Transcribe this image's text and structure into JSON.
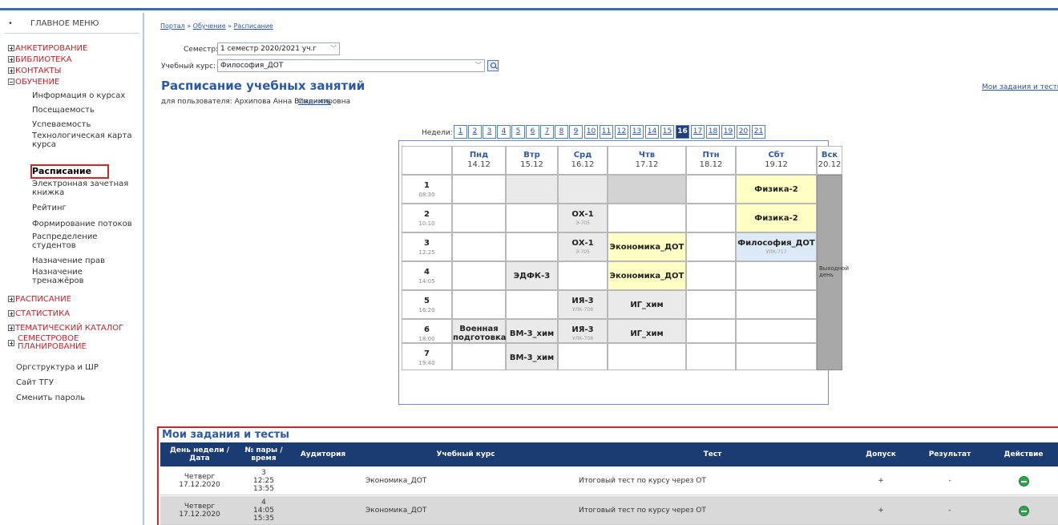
{
  "sidebar": {
    "main_menu": "ГЛАВНОЕ МЕНЮ",
    "sections": {
      "survey": "АНКЕТИРОВАНИЕ",
      "library": "БИБЛИОТЕКА",
      "contacts": "КОНТАКТЫ",
      "education": "ОБУЧЕНИЕ",
      "timetable": "РАСПИСАНИЕ",
      "statistics": "СТАТИСТИКА",
      "catalog": "ТЕМАТИЧЕСКИЙ КАТАЛОГ",
      "planning": "СЕМЕСТРОВОЕ ПЛАНИРОВАНИЕ"
    },
    "education_items": {
      "course_info": "Информация о курсах",
      "attendance": "Посещаемость",
      "progress": "Успеваемость",
      "tech_map": "Технологическая карта курса",
      "schedule": "Расписание",
      "gradebook": "Электронная зачетная книжка",
      "rating": "Рейтинг",
      "streams": "Формирование потоков",
      "distribution": "Распределение студентов",
      "rights": "Назначение прав",
      "trainers": "Назначение тренажёров"
    },
    "org_structure": "Оргструктура и ШР",
    "site": "Сайт ТГУ",
    "change_password": "Сменить пароль"
  },
  "breadcrumb": {
    "portal": "Портал",
    "education": "Обучение",
    "schedule": "Расписание",
    "sep": " » "
  },
  "filters": {
    "semester_label": "Семестр:",
    "semester_value": "1 семестр 2020/2021 уч.г",
    "course_label": "Учебный курс:",
    "course_value": "Философия_ДОТ"
  },
  "page_title": "Расписание учебных занятий",
  "my_tasks_link": "Мои задания и тесты",
  "user_line": "для пользователя: Архипова Анна Владимировна",
  "change_link": "Сменить",
  "weeks": {
    "label": "Недели:",
    "list": [
      "1",
      "2",
      "3",
      "4",
      "5",
      "6",
      "7",
      "8",
      "9",
      "10",
      "11",
      "12",
      "13",
      "14",
      "15",
      "16",
      "17",
      "18",
      "19",
      "20",
      "21"
    ],
    "current": "16"
  },
  "schedule": {
    "days": [
      {
        "name": "Пнд",
        "date": "14.12"
      },
      {
        "name": "Втр",
        "date": "15.12"
      },
      {
        "name": "Срд",
        "date": "16.12"
      },
      {
        "name": "Чтв",
        "date": "17.12"
      },
      {
        "name": "Птн",
        "date": "18.12"
      },
      {
        "name": "Сбт",
        "date": "19.12"
      },
      {
        "name": "Вск",
        "date": "20.12"
      }
    ],
    "pairs": [
      {
        "num": "1",
        "time": "08:30"
      },
      {
        "num": "2",
        "time": "10:10"
      },
      {
        "num": "3",
        "time": "12:25"
      },
      {
        "num": "4",
        "time": "14:05"
      },
      {
        "num": "5",
        "time": "16:20"
      },
      {
        "num": "6",
        "time": "18:00"
      },
      {
        "num": "7",
        "time": "19:40"
      }
    ],
    "lessons": {
      "sat_1": "Физика-2",
      "wed_2": "ОХ-1",
      "wed_2_room": "Э-705",
      "sat_2": "Физика-2",
      "wed_3": "ОХ-1",
      "wed_3_room": "Э-705",
      "thu_3": "Экономика_ДОТ",
      "sat_3": "Философия_ДОТ",
      "sat_3_room": "УЛК-717",
      "tue_4": "ЭДФК-3",
      "thu_4": "Экономика_ДОТ",
      "wed_5": "ИЯ-3",
      "wed_5_room": "УЛК-708",
      "thu_5": "ИГ_хим",
      "mon_6": "Военная подготовка",
      "tue_6": "ВМ-3_хим",
      "wed_6": "ИЯ-3",
      "wed_6_room": "УЛК-708",
      "thu_6": "ИГ_хим",
      "tue_7": "ВМ-3_хим"
    },
    "day_off": "Выходной день"
  },
  "tasks": {
    "title": "Мои задания и тесты",
    "columns": [
      "День недели / Дата",
      "№ пары / время",
      "Аудитория",
      "Учебный курс",
      "Тест",
      "Допуск",
      "Результат",
      "Действие"
    ],
    "rows": [
      {
        "day": "Четверг",
        "date": "17.12.2020",
        "pair": "3",
        "start": "12:25",
        "end": "13:55",
        "room": "",
        "course": "Экономика_ДОТ",
        "test": "Итоговый тест по курсу через ОТ",
        "access": "+",
        "result": "-"
      },
      {
        "day": "Четверг",
        "date": "17.12.2020",
        "pair": "4",
        "start": "14:05",
        "end": "15:35",
        "room": "",
        "course": "Экономика_ДОТ",
        "test": "Итоговый тест по курсу через ОТ",
        "access": "+",
        "result": "-"
      }
    ]
  },
  "colors": {
    "accent": "#2c5aa0",
    "header_dark": "#1b3b73",
    "highlight_red": "#d3262b",
    "lesson_yellow": "#ffffc3",
    "lesson_blue": "#dce9f7",
    "action_green": "#2ea44f"
  }
}
